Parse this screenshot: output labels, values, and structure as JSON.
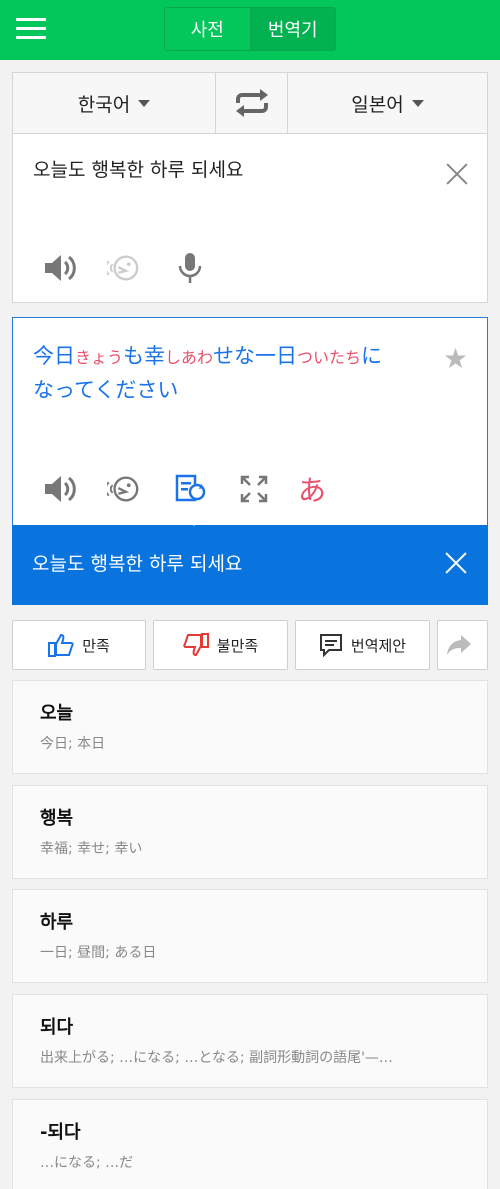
{
  "header": {
    "tabs": [
      {
        "label": "사전",
        "active": false
      },
      {
        "label": "번역기",
        "active": true
      }
    ],
    "accent": "#03c75a"
  },
  "source": {
    "lang": "한국어",
    "target_lang": "일본어",
    "text": "오늘도 행복한 하루 되세요"
  },
  "result": {
    "segments": [
      {
        "text": "今日",
        "type": "kanji"
      },
      {
        "text": "きょう",
        "type": "furi"
      },
      {
        "text": "も",
        "type": "kana"
      },
      {
        "text": "幸",
        "type": "kanji"
      },
      {
        "text": "しあわ",
        "type": "furi"
      },
      {
        "text": "せな",
        "type": "kana"
      },
      {
        "text": "一日",
        "type": "kanji"
      },
      {
        "text": "ついたち",
        "type": "furi"
      },
      {
        "text": "に",
        "type": "kana"
      },
      {
        "text": "なってください",
        "type": "kana"
      }
    ],
    "reverse_text": "오늘도 행복한 하루 되세요",
    "hiragana_glyph": "あ",
    "colors": {
      "result": "#1a73e8",
      "furigana": "#e8516b",
      "banner": "#0a74de"
    }
  },
  "feedback": {
    "like_label": "만족",
    "dislike_label": "불만족",
    "suggest_label": "번역제안"
  },
  "words": [
    {
      "word": "오늘",
      "def": "今日; 本日"
    },
    {
      "word": "행복",
      "def": "幸福; 幸せ; 幸い"
    },
    {
      "word": "하루",
      "def": "一日; 昼間; ある日"
    },
    {
      "word": "되다",
      "def": "出来上がる; …になる; …となる; 副詞形動詞の語尾'—…"
    },
    {
      "word": "-되다",
      "def": "…になる; …だ"
    }
  ]
}
